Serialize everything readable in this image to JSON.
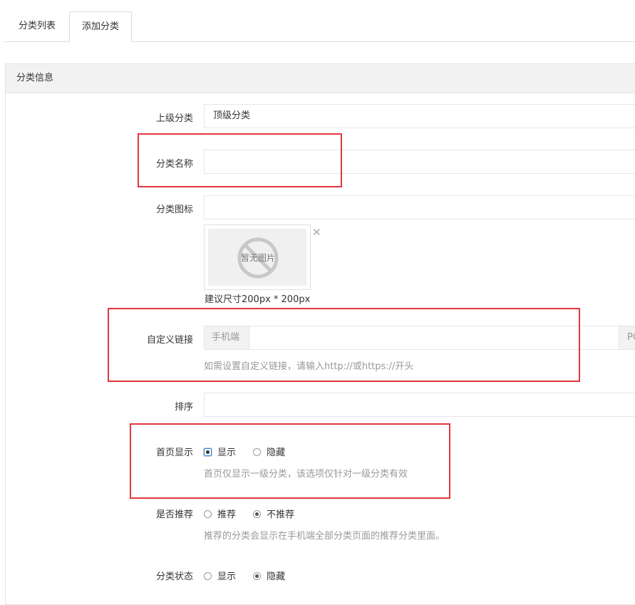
{
  "tabs": [
    {
      "label": "分类列表",
      "active": false
    },
    {
      "label": "添加分类",
      "active": true
    }
  ],
  "panel": {
    "title": "分类信息"
  },
  "form": {
    "parent": {
      "label": "上级分类",
      "value": "顶级分类"
    },
    "name": {
      "label": "分类名称",
      "value": ""
    },
    "icon": {
      "label": "分类图标",
      "value": "",
      "placeholder_text": "暂无图片",
      "size_note": "建议尺寸200px * 200px"
    },
    "custom_link": {
      "label": "自定义链接",
      "mobile_addon": "手机端",
      "pc_addon": "PC",
      "hint": "如需设置自定义链接，请输入http://或https://开头"
    },
    "sort": {
      "label": "排序",
      "value": ""
    },
    "home_display": {
      "label": "首页显示",
      "options": [
        "显示",
        "隐藏"
      ],
      "selected": "显示",
      "hint": "首页仅显示一级分类，该选项仅针对一级分类有效"
    },
    "recommend": {
      "label": "是否推荐",
      "options": [
        "推荐",
        "不推荐"
      ],
      "selected": "不推荐",
      "hint": "推荐的分类会显示在手机端全部分类页面的推荐分类里面。"
    },
    "status": {
      "label": "分类状态",
      "options": [
        "显示",
        "隐藏"
      ],
      "selected": "隐藏"
    }
  },
  "colors": {
    "highlight": "#e0383e",
    "hint": "#999999",
    "border": "#e6e6e6"
  }
}
